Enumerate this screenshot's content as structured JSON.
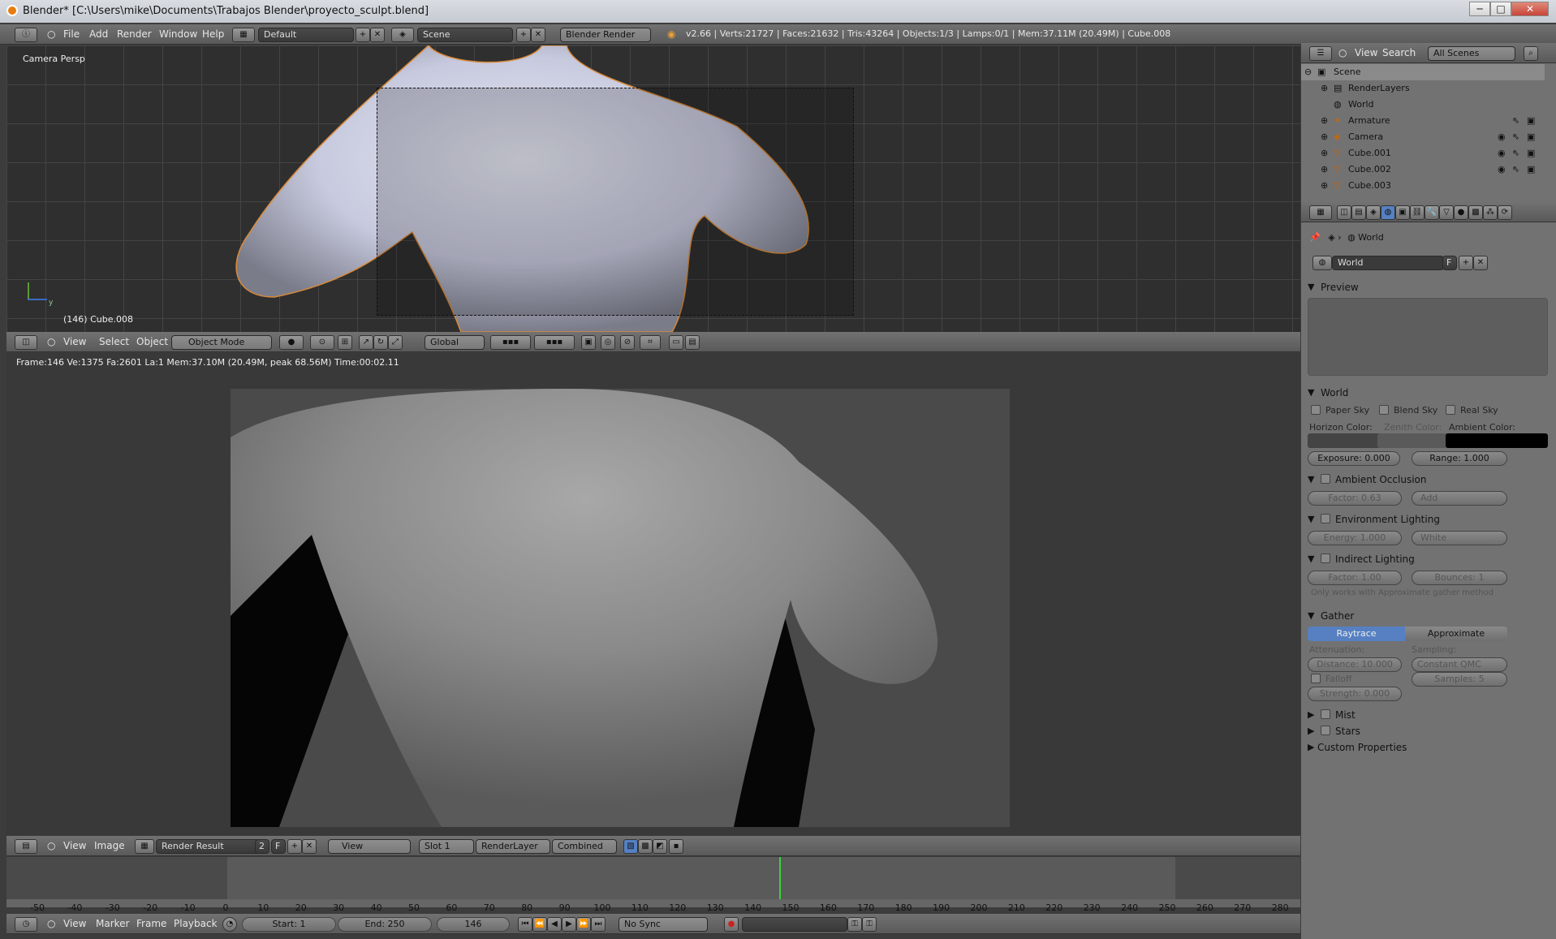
{
  "window": {
    "title": "Blender* [C:\\Users\\mike\\Documents\\Trabajos Blender\\proyecto_sculpt.blend]",
    "min": "─",
    "max": "□",
    "close": "✕"
  },
  "menu": {
    "items": [
      "File",
      "Add",
      "Render",
      "Window",
      "Help"
    ],
    "layout": "Default",
    "scene": "Scene",
    "engine": "Blender Render",
    "stats": "v2.66 | Verts:21727 | Faces:21632 | Tris:43264 | Objects:1/3 | Lamps:0/1 | Mem:37.11M (20.49M) | Cube.008"
  },
  "viewport": {
    "view_label": "Camera Persp",
    "object_label": "(146) Cube.008",
    "axis_y": "y"
  },
  "view3d_header": {
    "items": [
      "View",
      "Select",
      "Object"
    ],
    "mode": "Object Mode",
    "orientation": "Global"
  },
  "render_view": {
    "info": "Frame:146 Ve:1375 Fa:2601 La:1 Mem:37.10M (20.49M, peak 68.56M) Time:00:02.11"
  },
  "image_header": {
    "items": [
      "View",
      "Image"
    ],
    "image": "Render Result",
    "users": "2",
    "fake": "F",
    "view": "View",
    "slot": "Slot 1",
    "layer": "RenderLayer",
    "pass": "Combined"
  },
  "timeline": {
    "ticks": [
      "-50",
      "-40",
      "-30",
      "-20",
      "-10",
      "0",
      "10",
      "20",
      "30",
      "40",
      "50",
      "60",
      "70",
      "80",
      "90",
      "100",
      "110",
      "120",
      "130",
      "140",
      "150",
      "160",
      "170",
      "180",
      "190",
      "200",
      "210",
      "220",
      "230",
      "240",
      "250",
      "260",
      "270",
      "280"
    ],
    "current": "146"
  },
  "timeline_header": {
    "items": [
      "View",
      "Marker",
      "Frame",
      "Playback"
    ],
    "start": "Start: 1",
    "end": "End: 250",
    "frame": "146",
    "sync": "No Sync"
  },
  "outliner": {
    "menu": [
      "View",
      "Search"
    ],
    "filter": "All Scenes",
    "items": [
      "Scene",
      "RenderLayers",
      "World",
      "Armature",
      "Camera",
      "Cube.001",
      "Cube.002",
      "Cube.003"
    ]
  },
  "properties": {
    "context": "World",
    "world_name": "World",
    "fake": "F",
    "preview": "Preview",
    "world_panel": {
      "title": "World",
      "paper": "Paper Sky",
      "blend": "Blend Sky",
      "real": "Real Sky",
      "horizon": "Horizon Color:",
      "zenith": "Zenith Color:",
      "ambient": "Ambient Color:",
      "exposure": "Exposure: 0.000",
      "range": "Range: 1.000"
    },
    "ao": {
      "title": "Ambient Occlusion",
      "factor": "Factor: 0.63",
      "blend": "Add"
    },
    "env": {
      "title": "Environment Lighting",
      "energy": "Energy: 1.000",
      "color": "White"
    },
    "indirect": {
      "title": "Indirect Lighting",
      "factor": "Factor: 1.00",
      "bounces": "Bounces: 1",
      "note": "Only works with Approximate gather method"
    },
    "gather": {
      "title": "Gather",
      "raytrace": "Raytrace",
      "approx": "Approximate",
      "atten": "Attenuation:",
      "sampling": "Sampling:",
      "distance": "Distance: 10.000",
      "method": "Constant QMC",
      "falloff": "Falloff",
      "samples": "Samples: 5",
      "strength": "Strength: 0.000"
    },
    "mist": "Mist",
    "stars": "Stars",
    "custom": "Custom Properties"
  },
  "colors": {
    "accent": "#5680c2",
    "frame_line": "#3bd23d",
    "ambient": "#000000"
  }
}
